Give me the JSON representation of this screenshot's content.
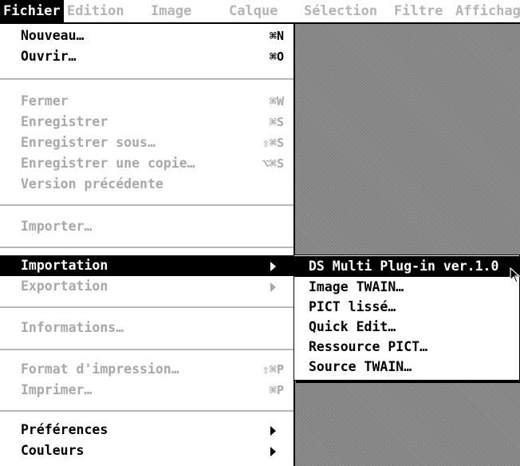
{
  "menubar": {
    "items": [
      {
        "label": "Fichier",
        "active": true
      },
      {
        "label": "Edition",
        "active": false
      },
      {
        "label": "Image",
        "active": false
      },
      {
        "label": "Calque",
        "active": false
      },
      {
        "label": "Sélection",
        "active": false
      },
      {
        "label": "Filtre",
        "active": false
      },
      {
        "label": "Affichag",
        "active": false
      }
    ]
  },
  "file_menu": {
    "items": [
      {
        "label": "Nouveau…",
        "shortcut": "⌘N",
        "enabled": true
      },
      {
        "label": "Ouvrir…",
        "shortcut": "⌘O",
        "enabled": true
      },
      {
        "label": "Fermer",
        "shortcut": "⌘W",
        "enabled": false
      },
      {
        "label": "Enregistrer",
        "shortcut": "⌘S",
        "enabled": false
      },
      {
        "label": "Enregistrer sous…",
        "shortcut": "⇧⌘S",
        "enabled": false
      },
      {
        "label": "Enregistrer une copie…",
        "shortcut": "⌥⌘S",
        "enabled": false
      },
      {
        "label": "Version précédente",
        "shortcut": "",
        "enabled": false
      },
      {
        "label": "Importer…",
        "shortcut": "",
        "enabled": false
      },
      {
        "label": "Importation",
        "shortcut": "",
        "enabled": true,
        "submenu": true,
        "highlighted": true
      },
      {
        "label": "Exportation",
        "shortcut": "",
        "enabled": false,
        "submenu": true
      },
      {
        "label": "Informations…",
        "shortcut": "",
        "enabled": false
      },
      {
        "label": "Format d'impression…",
        "shortcut": "⇧⌘P",
        "enabled": false
      },
      {
        "label": "Imprimer…",
        "shortcut": "⌘P",
        "enabled": false
      },
      {
        "label": "Préférences",
        "shortcut": "",
        "enabled": true,
        "submenu": true
      },
      {
        "label": "Couleurs",
        "shortcut": "",
        "enabled": true,
        "submenu": true
      }
    ]
  },
  "import_submenu": {
    "items": [
      {
        "label": "DS Multi Plug-in ver.1.0",
        "highlighted": true
      },
      {
        "label": "Image TWAIN…"
      },
      {
        "label": "PICT lissé…"
      },
      {
        "label": "Quick Edit…"
      },
      {
        "label": "Ressource PICT…"
      },
      {
        "label": "Source TWAIN…"
      }
    ]
  },
  "icons": {
    "submenu_arrow": "triangle-right-icon",
    "cursor": "arrow-cursor-icon"
  },
  "colors": {
    "highlight": "#000000",
    "disabled_text": "#a8a8a8",
    "separator": "#b8b8b8",
    "desktop": "#8a8a8a"
  }
}
